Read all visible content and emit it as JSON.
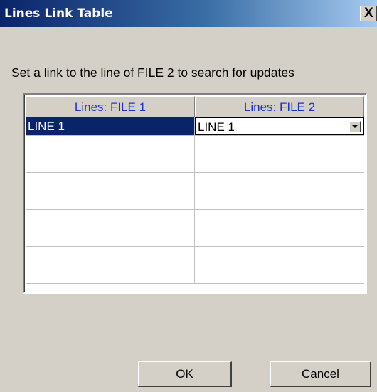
{
  "window": {
    "title": "Lines Link Table",
    "close_label": "X"
  },
  "instruction": "Set a link to the line of FILE 2  to search for updates",
  "table": {
    "columns": [
      "Lines: FILE 1",
      "Lines: FILE 2"
    ],
    "rows": [
      {
        "file1": "LINE 1",
        "file2": "LINE 1"
      },
      {
        "file1": "",
        "file2": ""
      },
      {
        "file1": "",
        "file2": ""
      },
      {
        "file1": "",
        "file2": ""
      },
      {
        "file1": "",
        "file2": ""
      },
      {
        "file1": "",
        "file2": ""
      },
      {
        "file1": "",
        "file2": ""
      },
      {
        "file1": "",
        "file2": ""
      },
      {
        "file1": "",
        "file2": ""
      }
    ]
  },
  "buttons": {
    "ok": "OK",
    "cancel": "Cancel"
  },
  "colors": {
    "titlebar_start": "#0a246a",
    "header_text": "#1e32c8",
    "selection": "#0a246a",
    "face": "#d4d0c8"
  }
}
